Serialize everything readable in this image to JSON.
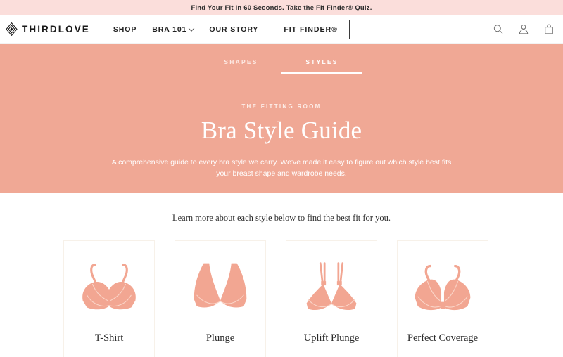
{
  "promo": {
    "text": "Find Your Fit in 60 Seconds. Take the Fit Finder® Quiz."
  },
  "header": {
    "brand_name": "THIRDLOVE",
    "brand_mark_icon": "diamond-logo-icon",
    "nav": [
      {
        "label": "SHOP",
        "has_chevron": false
      },
      {
        "label": "BRA 101",
        "has_chevron": true
      },
      {
        "label": "OUR STORY",
        "has_chevron": false
      }
    ],
    "cta_label": "FIT FINDER®",
    "actions": [
      {
        "icon": "search-icon"
      },
      {
        "icon": "account-icon"
      },
      {
        "icon": "shopping-bag-icon"
      }
    ]
  },
  "hero": {
    "tabs": [
      {
        "label": "SHAPES",
        "active": false
      },
      {
        "label": "STYLES",
        "active": true
      }
    ],
    "eyebrow": "THE FITTING ROOM",
    "title": "Bra Style Guide",
    "description": "A comprehensive guide to every bra style we carry. We've made it easy to figure out which style best fits your breast shape and wardrobe needs.",
    "background_color": "#f0a895"
  },
  "styles_section": {
    "intro": "Learn more about each style below to find the best fit for you.",
    "cards": [
      {
        "label": "T-Shirt",
        "art": "bra-tshirt-icon"
      },
      {
        "label": "Plunge",
        "art": "bra-plunge-icon"
      },
      {
        "label": "Uplift Plunge",
        "art": "bra-uplift-plunge-icon"
      },
      {
        "label": "Perfect Coverage",
        "art": "bra-perfect-coverage-icon"
      }
    ],
    "art_color": "#f2a692",
    "art_line_color": "#f7cfc2"
  },
  "colors": {
    "banner": "#fbdedb",
    "hero": "#f0a895",
    "card_border": "#f7f1e9",
    "text": "#2c2c2c"
  }
}
